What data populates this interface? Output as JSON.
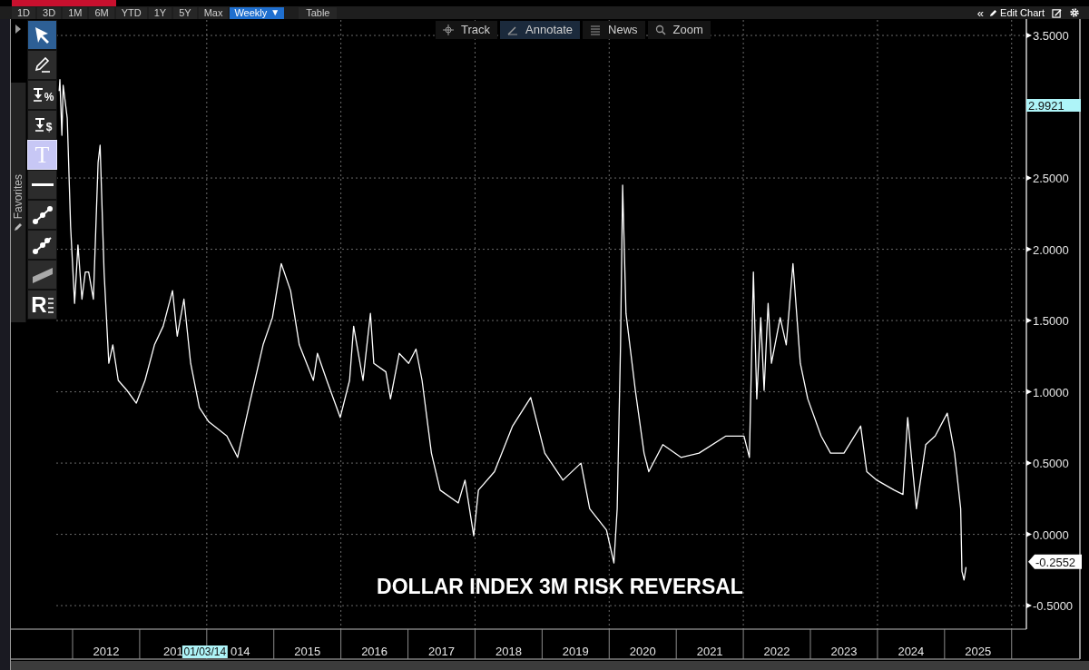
{
  "range_buttons": [
    {
      "label": "1D",
      "selected": false
    },
    {
      "label": "3D",
      "selected": false
    },
    {
      "label": "1M",
      "selected": false
    },
    {
      "label": "6M",
      "selected": false
    },
    {
      "label": "YTD",
      "selected": false
    },
    {
      "label": "1Y",
      "selected": false
    },
    {
      "label": "5Y",
      "selected": false
    },
    {
      "label": "Max",
      "selected": false
    }
  ],
  "frequency": {
    "label": "Weekly",
    "caret": "▼"
  },
  "table_button": {
    "label": "Table"
  },
  "toolbar_right": {
    "collapse": "«",
    "edit_chart": "Edit Chart"
  },
  "chart_modes": [
    {
      "label": "Track",
      "selected": false
    },
    {
      "label": "Annotate",
      "selected": true
    },
    {
      "label": "News",
      "selected": false
    },
    {
      "label": "Zoom",
      "selected": false
    }
  ],
  "drawing_tools": [
    {
      "kind": "pointer",
      "selected": true,
      "hovered": false
    },
    {
      "kind": "pen",
      "selected": false,
      "hovered": false
    },
    {
      "kind": "percent",
      "glyph": "%",
      "selected": false,
      "hovered": false
    },
    {
      "kind": "dollar",
      "glyph": "$",
      "selected": false,
      "hovered": false
    },
    {
      "kind": "text",
      "glyph": "T",
      "selected": false,
      "hovered": true
    },
    {
      "kind": "hline",
      "selected": false,
      "hovered": false
    },
    {
      "kind": "trend",
      "selected": false,
      "hovered": false
    },
    {
      "kind": "trend2",
      "selected": false,
      "hovered": false
    },
    {
      "kind": "channel",
      "selected": false,
      "hovered": false
    },
    {
      "kind": "ruler",
      "glyph": "R",
      "selected": false,
      "hovered": false
    }
  ],
  "favorites": {
    "label": "Favorites"
  },
  "chart": {
    "chart_data": {
      "type": "line",
      "title": "DOLLAR INDEX 3M RISK REVERSAL",
      "x": [
        2011.8,
        2011.81,
        2011.84,
        2011.86,
        2011.92,
        2011.97,
        2012.03,
        2012.08,
        2012.14,
        2012.19,
        2012.24,
        2012.31,
        2012.38,
        2012.41,
        2012.47,
        2012.54,
        2012.6,
        2012.68,
        2012.81,
        2012.95,
        2013.08,
        2013.22,
        2013.35,
        2013.49,
        2013.56,
        2013.66,
        2013.76,
        2013.89,
        2014.03,
        2014.3,
        2014.46,
        2014.64,
        2014.84,
        2014.98,
        2015.11,
        2015.25,
        2015.38,
        2015.59,
        2015.65,
        2015.79,
        2015.99,
        2016.13,
        2016.19,
        2016.33,
        2016.44,
        2016.49,
        2016.67,
        2016.74,
        2016.87,
        2017.01,
        2017.12,
        2017.21,
        2017.35,
        2017.48,
        2017.75,
        2017.85,
        2017.98,
        2018.05,
        2018.29,
        2018.56,
        2018.83,
        2019.04,
        2019.31,
        2019.58,
        2019.71,
        2019.96,
        2020.07,
        2020.12,
        2020.17,
        2020.2,
        2020.25,
        2020.39,
        2020.52,
        2020.59,
        2020.8,
        2021.07,
        2021.34,
        2021.74,
        2022.01,
        2022.09,
        2022.15,
        2022.2,
        2022.26,
        2022.31,
        2022.37,
        2022.42,
        2022.55,
        2022.64,
        2022.74,
        2022.85,
        2022.96,
        2023.16,
        2023.3,
        2023.5,
        2023.75,
        2023.84,
        2023.99,
        2024.25,
        2024.38,
        2024.45,
        2024.58,
        2024.72,
        2024.86,
        2025.04,
        2025.15,
        2025.24,
        2025.26,
        2025.29,
        2025.32
      ],
      "series": [
        {
          "color": "#ffffff",
          "values": [
            3.11,
            3.19,
            2.8,
            3.15,
            2.92,
            2.16,
            1.62,
            2.03,
            1.65,
            1.84,
            1.84,
            1.65,
            2.61,
            2.73,
            1.84,
            1.2,
            1.33,
            1.08,
            1.01,
            0.92,
            1.08,
            1.33,
            1.46,
            1.71,
            1.39,
            1.65,
            1.2,
            0.89,
            0.79,
            0.69,
            0.54,
            0.92,
            1.33,
            1.52,
            1.9,
            1.71,
            1.33,
            1.08,
            1.27,
            1.08,
            0.82,
            1.08,
            1.46,
            1.08,
            1.55,
            1.2,
            1.14,
            0.95,
            1.27,
            1.2,
            1.3,
            1.08,
            0.57,
            0.31,
            0.22,
            0.38,
            -0.01,
            0.31,
            0.44,
            0.76,
            0.96,
            0.57,
            0.38,
            0.5,
            0.18,
            0.03,
            -0.2,
            0.18,
            1.33,
            2.45,
            1.55,
            1.01,
            0.57,
            0.44,
            0.63,
            0.54,
            0.57,
            0.69,
            0.69,
            0.54,
            1.84,
            0.95,
            1.52,
            1.01,
            1.62,
            1.2,
            1.52,
            1.33,
            1.9,
            1.2,
            0.95,
            0.69,
            0.57,
            0.57,
            0.76,
            0.44,
            0.38,
            0.31,
            0.28,
            0.82,
            0.18,
            0.63,
            0.69,
            0.85,
            0.57,
            0.18,
            -0.26,
            -0.32,
            -0.23
          ]
        }
      ],
      "xlim": [
        2011.08,
        2026.22
      ],
      "ylim": [
        -0.665,
        3.615
      ],
      "grid": true,
      "xticks": [
        {
          "value": 2012.5,
          "label": "2012"
        },
        {
          "value": 2015.5,
          "label": "2015"
        },
        {
          "value": 2016.5,
          "label": "2016"
        },
        {
          "value": 2017.5,
          "label": "2017"
        },
        {
          "value": 2018.5,
          "label": "2018"
        },
        {
          "value": 2019.5,
          "label": "2019"
        },
        {
          "value": 2020.5,
          "label": "2020"
        },
        {
          "value": 2021.5,
          "label": "2021"
        },
        {
          "value": 2022.5,
          "label": "2022"
        },
        {
          "value": 2023.5,
          "label": "2023"
        },
        {
          "value": 2024.5,
          "label": "2024"
        },
        {
          "value": 2025.5,
          "label": "2025"
        }
      ],
      "yticks": [
        {
          "value": 3.5,
          "label": "3.5000"
        },
        {
          "value": 2.5,
          "label": "2.5000"
        },
        {
          "value": 2,
          "label": "2.0000"
        },
        {
          "value": 1.5,
          "label": "1.5000"
        },
        {
          "value": 1,
          "label": "1.0000"
        },
        {
          "value": 0.5,
          "label": "0.5000"
        },
        {
          "value": 0,
          "label": "0.0000"
        },
        {
          "value": -0.5,
          "label": "-0.5000"
        }
      ]
    },
    "cut_year_labels": [
      "201",
      "014"
    ],
    "value_tags": [
      {
        "kind": "cursor",
        "text": "2.9921",
        "color": "#aef4f8"
      },
      {
        "kind": "last",
        "text": "-0.2552",
        "color": "#ffffff"
      }
    ],
    "cursor_date": {
      "text": "01/03/14",
      "color": "#aef4f8"
    }
  }
}
